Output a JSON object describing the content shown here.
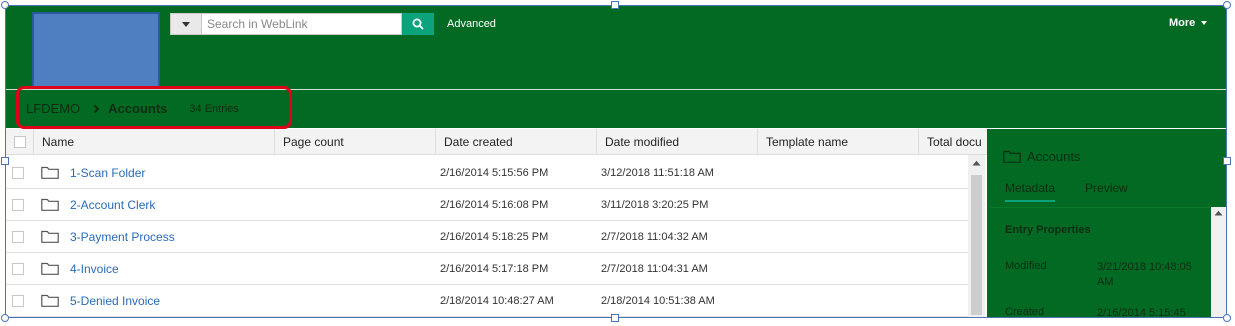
{
  "search": {
    "placeholder": "Search in WebLink",
    "advanced_label": "Advanced"
  },
  "header": {
    "more_label": "More"
  },
  "breadcrumb": {
    "root": "LFDEMO",
    "current": "Accounts",
    "entries": "34 Entries"
  },
  "table": {
    "columns": [
      "Name",
      "Page count",
      "Date created",
      "Date modified",
      "Template name",
      "Total docu"
    ],
    "rows": [
      {
        "name": "1-Scan Folder",
        "created": "2/16/2014 5:15:56 PM",
        "modified": "3/12/2018 11:51:18 AM"
      },
      {
        "name": "2-Account Clerk",
        "created": "2/16/2014 5:16:08 PM",
        "modified": "3/11/2018 3:20:25 PM"
      },
      {
        "name": "3-Payment Process",
        "created": "2/16/2014 5:18:25 PM",
        "modified": "2/7/2018 11:04:32 AM"
      },
      {
        "name": "4-Invoice",
        "created": "2/16/2014 5:17:18 PM",
        "modified": "2/7/2018 11:04:31 AM"
      },
      {
        "name": "5-Denied Invoice",
        "created": "2/18/2014 10:48:27 AM",
        "modified": "2/18/2014 10:51:38 AM"
      }
    ]
  },
  "panel": {
    "title": "Accounts",
    "tabs": [
      "Metadata",
      "Preview"
    ],
    "section": "Entry Properties",
    "props": [
      {
        "label": "Modified",
        "value": "3/21/2018 10:48:05 AM"
      },
      {
        "label": "Created",
        "value": "2/16/2014 5:15:45"
      }
    ]
  },
  "colors": {
    "brand_green": "#026a22",
    "accent": "#0aa37c",
    "link": "#2a6bb5",
    "highlight": "#e0001a"
  }
}
